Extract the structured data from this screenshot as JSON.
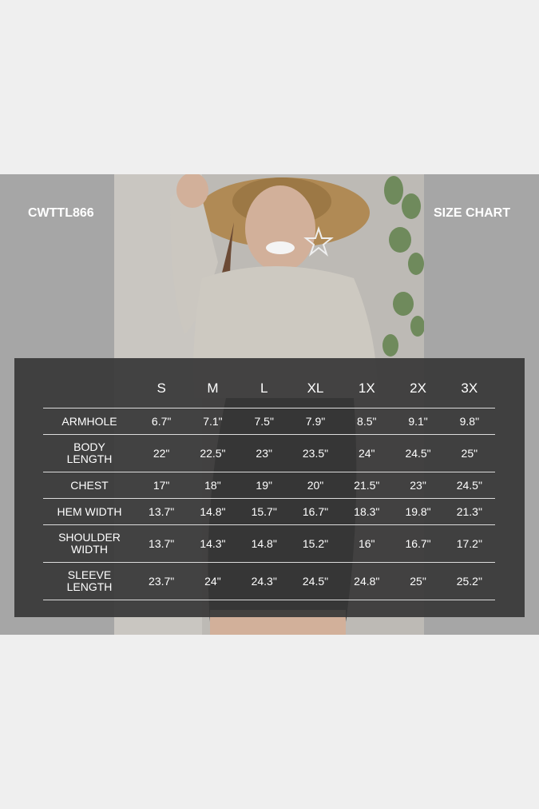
{
  "header": {
    "product_code": "CWTTL866",
    "title": "SIZE CHART"
  },
  "photo": {
    "description_icon": "model-photo"
  },
  "size_chart": {
    "sizes": [
      "S",
      "M",
      "L",
      "XL",
      "1X",
      "2X",
      "3X"
    ],
    "rows": [
      {
        "label": "ARMHOLE",
        "values": [
          "6.7\"",
          "7.1\"",
          "7.5\"",
          "7.9\"",
          "8.5\"",
          "9.1\"",
          "9.8\""
        ]
      },
      {
        "label": "BODY\nLENGTH",
        "values": [
          "22\"",
          "22.5\"",
          "23\"",
          "23.5\"",
          "24\"",
          "24.5\"",
          "25\""
        ]
      },
      {
        "label": "CHEST",
        "values": [
          "17\"",
          "18\"",
          "19\"",
          "20\"",
          "21.5\"",
          "23\"",
          "24.5\""
        ]
      },
      {
        "label": "HEM WIDTH",
        "values": [
          "13.7\"",
          "14.8\"",
          "15.7\"",
          "16.7\"",
          "18.3\"",
          "19.8\"",
          "21.3\""
        ]
      },
      {
        "label": "SHOULDER\nWIDTH",
        "values": [
          "13.7\"",
          "14.3\"",
          "14.8\"",
          "15.2\"",
          "16\"",
          "16.7\"",
          "17.2\""
        ]
      },
      {
        "label": "SLEEVE\nLENGTH",
        "values": [
          "23.7\"",
          "24\"",
          "24.3\"",
          "24.5\"",
          "24.8\"",
          "25\"",
          "25.2\""
        ]
      }
    ]
  },
  "colors": {
    "page_bg": "#efefef",
    "band_bg": "#a6a6a6",
    "panel_bg": "#383838",
    "text": "#ffffff"
  }
}
